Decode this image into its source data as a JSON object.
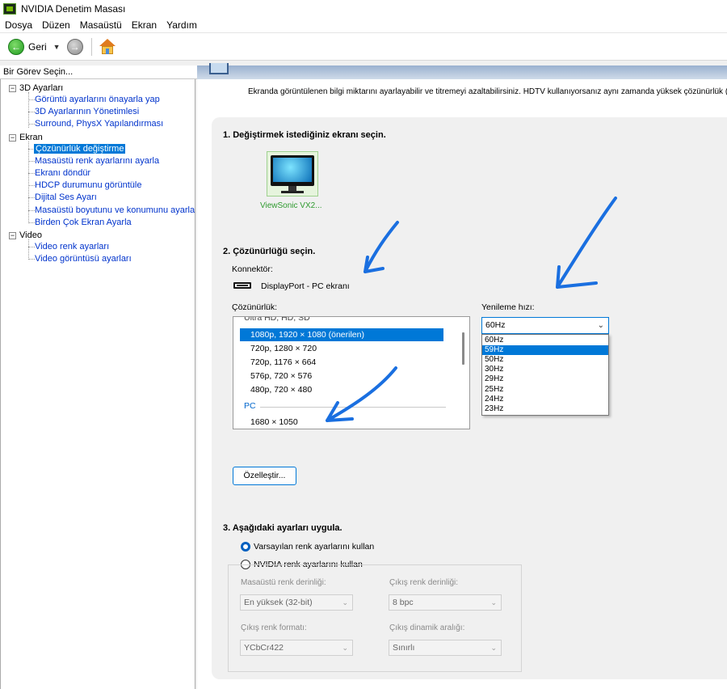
{
  "window": {
    "title": "NVIDIA Denetim Masası"
  },
  "menu": [
    "Dosya",
    "Düzen",
    "Masaüstü",
    "Ekran",
    "Yardım"
  ],
  "toolbar": {
    "back_label": "Geri"
  },
  "task_panel": {
    "header": "Bir Görev Seçin...",
    "categories": [
      {
        "label": "3D Ayarları",
        "toggle": "−",
        "items": [
          "Görüntü ayarlarını önayarla yap",
          "3D Ayarlarının Yönetimlesi",
          "Surround, PhysX Yapılandırması"
        ]
      },
      {
        "label": "Ekran",
        "toggle": "−",
        "items": [
          "Çözünürlük değiştirme",
          "Masaüstü renk ayarlarını ayarla",
          "Ekranı döndür",
          "HDCP durumunu görüntüle",
          "Dijital Ses Ayarı",
          "Masaüstü boyutunu ve konumunu ayarla",
          "Birden Çok Ekran Ayarla"
        ]
      },
      {
        "label": "Video",
        "toggle": "−",
        "items": [
          "Video renk ayarları",
          "Video görüntüsü ayarları"
        ]
      }
    ],
    "selected_item": "Çözünürlük değiştirme"
  },
  "page": {
    "description": "Ekranda görüntülenen bilgi miktarını ayarlayabilir ve titremeyi azaltabilirsiniz. HDTV kullanıyorsanız aynı zamanda yüksek çözünürlük (H",
    "section1_title": "1. Değiştirmek istediğiniz ekranı seçin.",
    "monitor_label": "ViewSonic VX2...",
    "section2_title": "2. Çözünürlüğü seçin.",
    "connector_label": "Konnektör:",
    "connector_value": "DisplayPort - PC ekranı",
    "resolution_label": "Çözünürlük:",
    "resolution_category_cut": "Ultra HD, HD, SD",
    "resolutions": [
      "1080p, 1920 × 1080 (önerilen)",
      "720p, 1280 × 720",
      "720p, 1176 × 664",
      "576p, 720 × 576",
      "480p, 720 × 480"
    ],
    "resolution_group_pc": "PC",
    "resolution_pc_first": "1680 × 1050",
    "selected_resolution": "1080p, 1920 × 1080 (önerilen)",
    "refresh_label": "Yenileme hızı:",
    "refresh_value": "60Hz",
    "refresh_options": [
      "60Hz",
      "59Hz",
      "50Hz",
      "30Hz",
      "29Hz",
      "25Hz",
      "24Hz",
      "23Hz"
    ],
    "refresh_highlighted": "59Hz",
    "customize_button": "Özelleştir...",
    "section3_title": "3. Aşağıdaki ayarları uygula.",
    "radio_default": "Varsayılan renk ayarlarını kullan",
    "radio_nvidia": "NVIDIA renk ayarlarını kullan",
    "desktop_depth_label": "Masaüstü renk derinliği:",
    "desktop_depth_value": "En yüksek (32-bit)",
    "output_depth_label": "Çıkış renk derinliği:",
    "output_depth_value": "8 bpc",
    "output_format_label": "Çıkış renk formatı:",
    "output_format_value": "YCbCr422",
    "output_range_label": "Çıkış dinamik aralığı:",
    "output_range_value": "Sınırlı"
  },
  "colors": {
    "selection": "#0078d7",
    "link": "#0033cc",
    "nvidia_green": "#76b900",
    "annotation_arrow": "#1a6fe0"
  }
}
